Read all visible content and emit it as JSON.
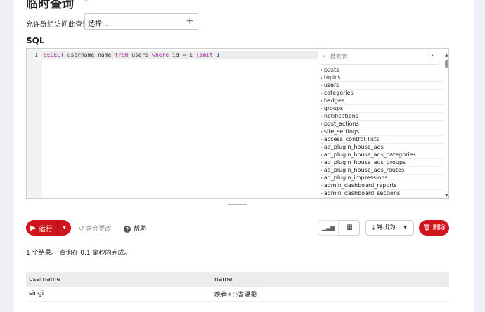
{
  "page": {
    "title": "临时查询",
    "title_icon": "edit-icon"
  },
  "group_access": {
    "label": "允许群组访问此查询",
    "select_value": "选择...",
    "add_symbol": "+"
  },
  "sql": {
    "label": "SQL",
    "line_number": "1",
    "tokens": {
      "select": "SELECT",
      "cols": " username,name ",
      "from": "from",
      "table": " users ",
      "where": "where",
      "col_id": " id ",
      "eq": "=",
      "val": " 1 ",
      "limit": "limit",
      "limit_val": " 1"
    }
  },
  "schema": {
    "search_placeholder": "搜索表",
    "tables": [
      "posts",
      "topics",
      "users",
      "categories",
      "badges",
      "groups",
      "notifications",
      "post_actions",
      "site_settings",
      "access_control_lists",
      "ad_plugin_house_ads",
      "ad_plugin_house_ads_categories",
      "ad_plugin_house_ads_groups",
      "ad_plugin_house_ads_routes",
      "ad_plugin_impressions",
      "admin_dashboard_reports",
      "admin_dashboard_sections"
    ]
  },
  "toolbar": {
    "run_label": "运行",
    "discard_label": "舍弃更改",
    "help_label": "帮助",
    "export_label": "导出为...",
    "delete_label": "删除"
  },
  "result": {
    "message": "1 个结果。 查询在 0.1 毫秒内完成。",
    "columns": [
      "username",
      "name"
    ],
    "rows": [
      [
        "singi",
        "晚巷✧◌寄温柔"
      ]
    ]
  },
  "colors": {
    "accent_red": "#d0141b",
    "keyword": "#a626a4",
    "number": "#0d47a1"
  }
}
